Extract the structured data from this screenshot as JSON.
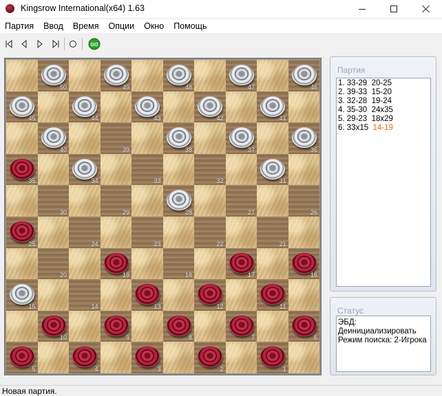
{
  "window": {
    "title": "Kingsrow International(x64) 1.63"
  },
  "menu": [
    "Партия",
    "Ввод",
    "Время",
    "Опции",
    "Окно",
    "Помощь"
  ],
  "toolbar": {
    "buttons": [
      "first-move-icon",
      "prev-move-icon",
      "next-move-icon",
      "last-move-icon",
      "circle-icon",
      "go-icon"
    ],
    "go_label": "GO"
  },
  "board": {
    "light_color": "#dcc08a",
    "dark_color": "#9a7d5c",
    "squares": [
      {
        "n": 50,
        "p": "w"
      },
      {
        "n": 49,
        "p": "w"
      },
      {
        "n": 48,
        "p": "w"
      },
      {
        "n": 47,
        "p": "w"
      },
      {
        "n": 46,
        "p": "w"
      },
      {
        "n": 45,
        "p": "w"
      },
      {
        "n": 44,
        "p": "w"
      },
      {
        "n": 43,
        "p": "w"
      },
      {
        "n": 42,
        "p": "w"
      },
      {
        "n": 41,
        "p": "w"
      },
      {
        "n": 40,
        "p": "w"
      },
      {
        "n": 39,
        "p": ""
      },
      {
        "n": 38,
        "p": "w"
      },
      {
        "n": 37,
        "p": "w"
      },
      {
        "n": 36,
        "p": "w"
      },
      {
        "n": 35,
        "p": "r"
      },
      {
        "n": 34,
        "p": "w"
      },
      {
        "n": 33,
        "p": ""
      },
      {
        "n": 32,
        "p": ""
      },
      {
        "n": 31,
        "p": "w"
      },
      {
        "n": 30,
        "p": ""
      },
      {
        "n": 29,
        "p": ""
      },
      {
        "n": 28,
        "p": "w"
      },
      {
        "n": 27,
        "p": ""
      },
      {
        "n": 26,
        "p": ""
      },
      {
        "n": 25,
        "p": "r"
      },
      {
        "n": 24,
        "p": ""
      },
      {
        "n": 23,
        "p": ""
      },
      {
        "n": 22,
        "p": ""
      },
      {
        "n": 21,
        "p": ""
      },
      {
        "n": 20,
        "p": ""
      },
      {
        "n": 19,
        "p": "r"
      },
      {
        "n": 18,
        "p": ""
      },
      {
        "n": 17,
        "p": "r"
      },
      {
        "n": 16,
        "p": "r"
      },
      {
        "n": 15,
        "p": "w"
      },
      {
        "n": 14,
        "p": ""
      },
      {
        "n": 13,
        "p": "r"
      },
      {
        "n": 12,
        "p": "r"
      },
      {
        "n": 11,
        "p": "r"
      },
      {
        "n": 10,
        "p": "r"
      },
      {
        "n": 9,
        "p": "r"
      },
      {
        "n": 8,
        "p": "r"
      },
      {
        "n": 7,
        "p": "r"
      },
      {
        "n": 6,
        "p": "r"
      },
      {
        "n": 5,
        "p": "r"
      },
      {
        "n": 4,
        "p": "r"
      },
      {
        "n": 3,
        "p": "r"
      },
      {
        "n": 2,
        "p": "r"
      },
      {
        "n": 1,
        "p": "r"
      }
    ]
  },
  "game_panel": {
    "title": "Партия",
    "moves": [
      {
        "text": "1. 33-29  20-25",
        "current": ""
      },
      {
        "text": "2. 39-33  15-20",
        "current": ""
      },
      {
        "text": "3. 32-28  19-24",
        "current": ""
      },
      {
        "text": "4. 35-30  24x35",
        "current": ""
      },
      {
        "text": "5. 29-23  18x29",
        "current": ""
      },
      {
        "text": "6. 33x15  ",
        "current": "14-19"
      }
    ]
  },
  "status_panel": {
    "title": "Статус",
    "lines": [
      "ЭБД:",
      "Деинициализировать",
      "Режим поиска: 2-Игрока"
    ]
  },
  "statusbar": {
    "text": "Новая партия."
  }
}
